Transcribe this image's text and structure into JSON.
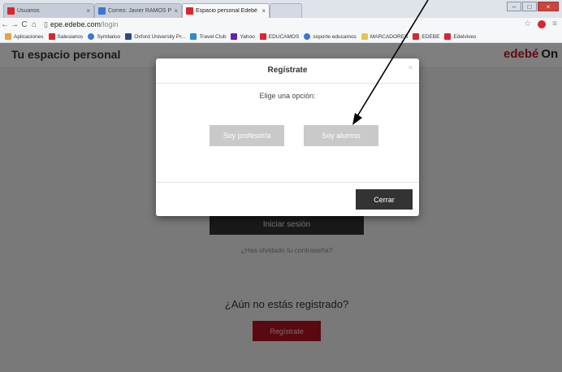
{
  "browser": {
    "tabs": [
      {
        "label": "Usuarios",
        "color": "#d8262b"
      },
      {
        "label": "Correo: Javier RAMOS PEÑ",
        "color": "#3a78d8"
      },
      {
        "label": "Espacio personal Edebé",
        "color": "#d8262b"
      }
    ],
    "url_host": "epe.edebe.com",
    "url_path": "/login",
    "bookmarks": [
      {
        "label": "Aplicaciones",
        "color": "#e8a23c"
      },
      {
        "label": "Salesianos",
        "color": "#d8262b"
      },
      {
        "label": "Symbaloo",
        "color": "#3a78d8"
      },
      {
        "label": "Oxford University Pr...",
        "color": "#2a4a8c"
      },
      {
        "label": "Travel Club",
        "color": "#2a8bd8"
      },
      {
        "label": "Yahoo",
        "color": "#6a1fb3"
      },
      {
        "label": "EDUCAMOS",
        "color": "#d8262b"
      },
      {
        "label": "soporte educamos",
        "color": "#3a78d8"
      },
      {
        "label": "MARCADORES",
        "color": "#e8c34c"
      },
      {
        "label": "EDEBE",
        "color": "#d8262b"
      },
      {
        "label": "Edelvives",
        "color": "#d8262b"
      }
    ]
  },
  "page": {
    "title": "Tu espacio personal",
    "logo_main": "edebé",
    "logo_suffix": "On",
    "login_button": "Iniciar sesión",
    "forgot_link": "¿Has olvidado tu contraseña?",
    "not_registered": "¿Aún no estás registrado?",
    "register_button": "Regístrate"
  },
  "modal": {
    "title": "Regístrate",
    "close_x": "×",
    "subtitle": "Elige una opción:",
    "teacher_button": "Soy profesor/a",
    "student_button": "Soy alumno",
    "close_button": "Cerrar"
  }
}
